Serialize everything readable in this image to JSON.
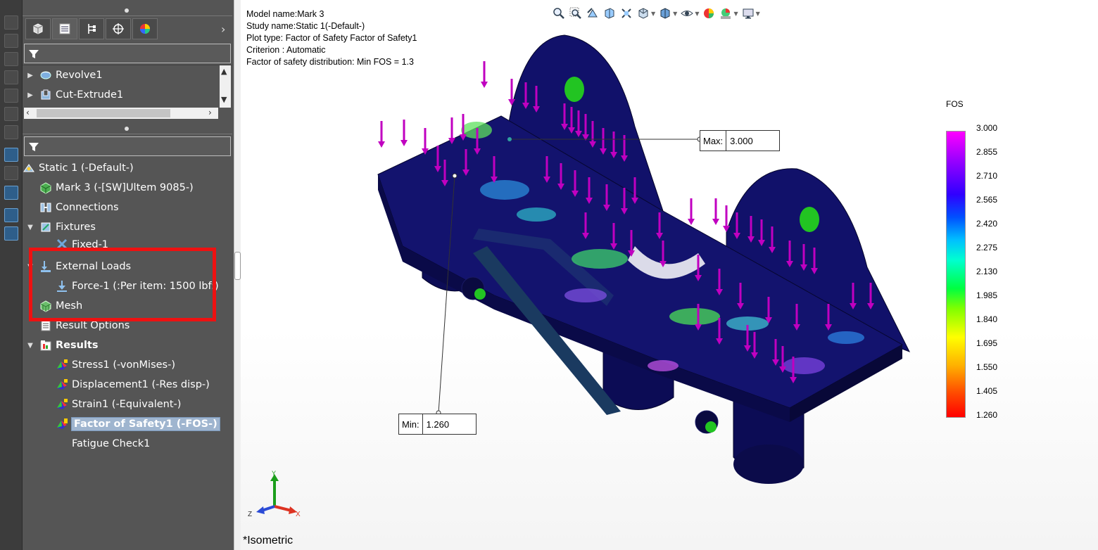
{
  "feature_tree": {
    "items": [
      {
        "label": "Revolve1"
      },
      {
        "label": "Cut-Extrude1"
      }
    ]
  },
  "simulation_tree": {
    "items": [
      {
        "label": "Static 1 (-Default-)"
      },
      {
        "label": "Mark 3 (-[SW]Ultem 9085-)"
      },
      {
        "label": "Connections"
      },
      {
        "label": "Fixtures"
      },
      {
        "label": "Fixed-1"
      },
      {
        "label": "External Loads"
      },
      {
        "label": "Force-1 (:Per item: 1500 lbf:)"
      },
      {
        "label": "Mesh"
      },
      {
        "label": "Result Options"
      },
      {
        "label": "Results"
      },
      {
        "label": "Stress1 (-vonMises-)"
      },
      {
        "label": "Displacement1 (-Res disp-)"
      },
      {
        "label": "Strain1 (-Equivalent-)"
      },
      {
        "label": "Factor of Safety1 (-FOS-)"
      },
      {
        "label": "Fatigue Check1"
      }
    ]
  },
  "plot_info": {
    "model_name": "Model name:Mark 3",
    "study_name": "Study name:Static 1(-Default-)",
    "plot_type": "Plot type: Factor of Safety Factor of Safety1",
    "criterion": "Criterion : Automatic",
    "distribution": "Factor of safety distribution: Min FOS = 1.3"
  },
  "callouts": {
    "max_label": "Max:",
    "max_value": "3.000",
    "min_label": "Min:",
    "min_value": "1.260"
  },
  "legend": {
    "title": "FOS",
    "ticks": [
      "3.000",
      "2.855",
      "2.710",
      "2.565",
      "2.420",
      "2.275",
      "2.130",
      "1.985",
      "1.840",
      "1.695",
      "1.550",
      "1.405",
      "1.260"
    ],
    "color_max": "#ff00ff",
    "color_min": "#ff0000"
  },
  "triad": {
    "y": "Y",
    "z": "Z",
    "x": "X"
  },
  "view_name": "*Isometric",
  "colors": {
    "panel_bg": "#555555",
    "highlight_box": "#ee1111",
    "selected_item": "#9fb5cf",
    "model_body": "#10105a",
    "load_arrow": "#c000c0"
  }
}
